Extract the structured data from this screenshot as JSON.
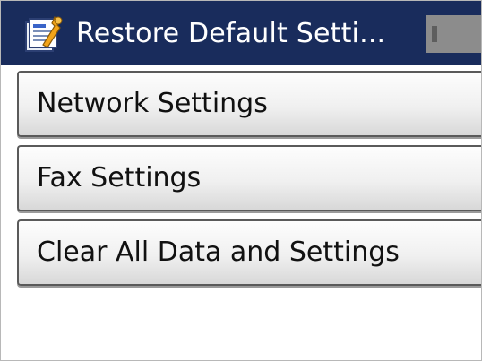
{
  "title_bar": {
    "title": "Restore Default Setti...",
    "icon": "settings-document-wrench-icon"
  },
  "menu": {
    "items": [
      {
        "label": "Network Settings"
      },
      {
        "label": "Fax Settings"
      },
      {
        "label": "Clear All Data and Settings"
      }
    ]
  },
  "colors": {
    "title_bar_background": "#192c5c",
    "title_text": "#ffffff",
    "item_border": "#5a5a5a",
    "item_text": "#111111"
  }
}
